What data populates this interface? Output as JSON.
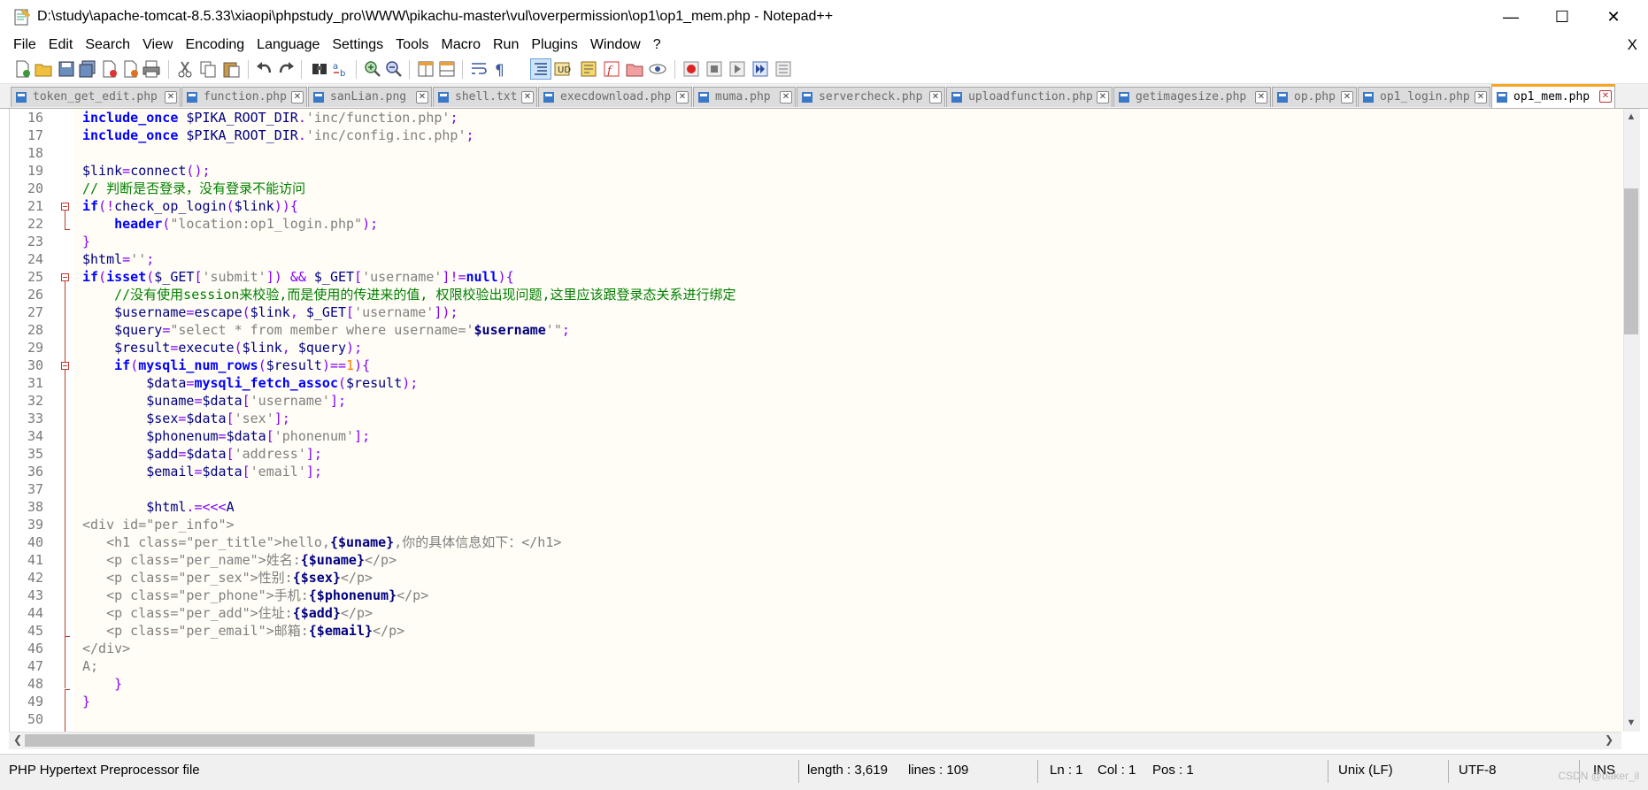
{
  "window": {
    "title": "D:\\study\\apache-tomcat-8.5.33\\xiaopi\\phpstudy_pro\\WWW\\pikachu-master\\vul\\overpermission\\op1\\op1_mem.php - Notepad++",
    "minimize": "—",
    "maximize": "☐",
    "close": "✕"
  },
  "menu": {
    "items": [
      "File",
      "Edit",
      "Search",
      "View",
      "Encoding",
      "Language",
      "Settings",
      "Tools",
      "Macro",
      "Run",
      "Plugins",
      "Window",
      "?"
    ],
    "close": "X"
  },
  "tabs": [
    {
      "label": "token_get_edit.php"
    },
    {
      "label": "function.php"
    },
    {
      "label": "sanLian.png"
    },
    {
      "label": "shell.txt"
    },
    {
      "label": "execdownload.php"
    },
    {
      "label": "muma.php"
    },
    {
      "label": "servercheck.php"
    },
    {
      "label": "uploadfunction.php"
    },
    {
      "label": "getimagesize.php"
    },
    {
      "label": "op.php"
    },
    {
      "label": "op1_login.php"
    },
    {
      "label": "op1_mem.php",
      "active": true
    }
  ],
  "editor": {
    "lines": [
      {
        "n": "16",
        "text": "include_once $PIKA_ROOT_DIR.'inc/function.php';"
      },
      {
        "n": "17",
        "text": "include_once $PIKA_ROOT_DIR.'inc/config.inc.php';"
      },
      {
        "n": "18",
        "text": ""
      },
      {
        "n": "19",
        "text": "$link=connect();"
      },
      {
        "n": "20",
        "text": "// 判断是否登录，没有登录不能访问"
      },
      {
        "n": "21",
        "text": "if(!check_op_login($link)){"
      },
      {
        "n": "22",
        "text": "    header(\"location:op1_login.php\");"
      },
      {
        "n": "23",
        "text": "}"
      },
      {
        "n": "24",
        "text": "$html='';"
      },
      {
        "n": "25",
        "text": "if(isset($_GET['submit']) && $_GET['username']!=null){"
      },
      {
        "n": "26",
        "text": "    //没有使用session来校验,而是使用的传进来的值, 权限校验出现问题,这里应该跟登录态关系进行绑定"
      },
      {
        "n": "27",
        "text": "    $username=escape($link, $_GET['username']);"
      },
      {
        "n": "28",
        "text": "    $query=\"select * from member where username='$username'\";"
      },
      {
        "n": "29",
        "text": "    $result=execute($link, $query);"
      },
      {
        "n": "30",
        "text": "    if(mysqli_num_rows($result)==1){"
      },
      {
        "n": "31",
        "text": "        $data=mysqli_fetch_assoc($result);"
      },
      {
        "n": "32",
        "text": "        $uname=$data['username'];"
      },
      {
        "n": "33",
        "text": "        $sex=$data['sex'];"
      },
      {
        "n": "34",
        "text": "        $phonenum=$data['phonenum'];"
      },
      {
        "n": "35",
        "text": "        $add=$data['address'];"
      },
      {
        "n": "36",
        "text": "        $email=$data['email'];"
      },
      {
        "n": "37",
        "text": ""
      },
      {
        "n": "38",
        "text": "        $html.=<<<A"
      },
      {
        "n": "39",
        "text": "<div id=\"per_info\">"
      },
      {
        "n": "40",
        "text": "   <h1 class=\"per_title\">hello,{$uname},你的具体信息如下：</h1>"
      },
      {
        "n": "41",
        "text": "   <p class=\"per_name\">姓名:{$uname}</p>"
      },
      {
        "n": "42",
        "text": "   <p class=\"per_sex\">性别:{$sex}</p>"
      },
      {
        "n": "43",
        "text": "   <p class=\"per_phone\">手机:{$phonenum}</p>"
      },
      {
        "n": "44",
        "text": "   <p class=\"per_add\">住址:{$add}</p>"
      },
      {
        "n": "45",
        "text": "   <p class=\"per_email\">邮箱:{$email}</p>"
      },
      {
        "n": "46",
        "text": "</div>"
      },
      {
        "n": "47",
        "text": "A;"
      },
      {
        "n": "48",
        "text": "    }"
      },
      {
        "n": "49",
        "text": "}"
      },
      {
        "n": "50",
        "text": ""
      }
    ]
  },
  "statusbar": {
    "file_type": "PHP Hypertext Preprocessor file",
    "length": "length : 3,619",
    "lines": "lines : 109",
    "ln": "Ln : 1",
    "col": "Col : 1",
    "pos": "Pos : 1",
    "eol": "Unix (LF)",
    "encoding": "UTF-8",
    "mode": "INS"
  },
  "watermark": "CSDN @baker_il"
}
